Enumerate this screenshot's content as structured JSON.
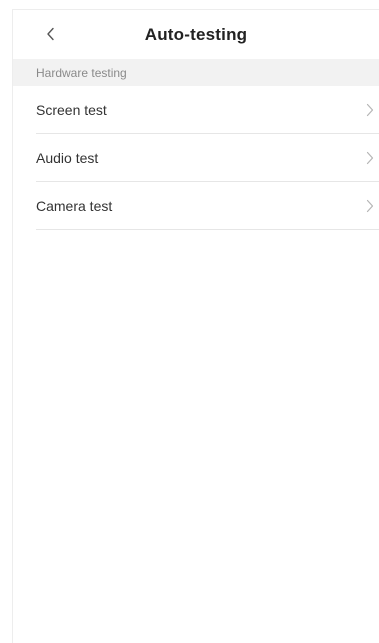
{
  "header": {
    "title": "Auto-testing",
    "back_icon": "chevron-left-icon"
  },
  "section": {
    "label": "Hardware testing"
  },
  "items": [
    {
      "label": "Screen test",
      "icon": "chevron-right-icon"
    },
    {
      "label": "Audio test",
      "icon": "chevron-right-icon"
    },
    {
      "label": "Camera test",
      "icon": "chevron-right-icon"
    }
  ],
  "colors": {
    "background": "#ffffff",
    "section_bg": "#f2f2f2",
    "title_text": "#222222",
    "item_text": "#333333",
    "section_text": "#8a8a8a",
    "divider": "#e6e6e6",
    "chevron": "#b5b5b5"
  }
}
